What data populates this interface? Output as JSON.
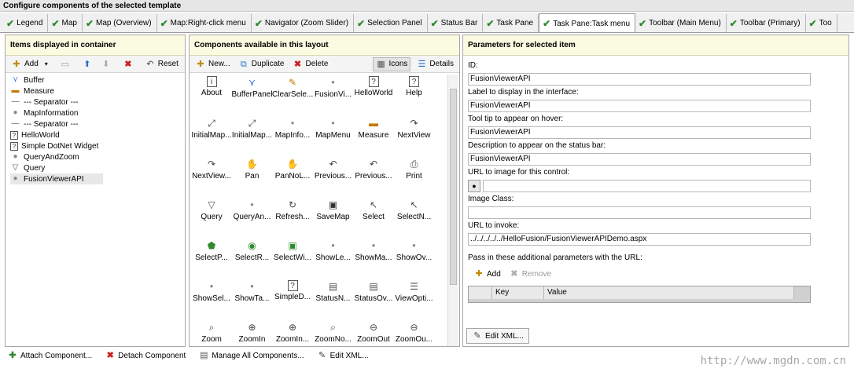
{
  "window_title": "Configure components of the selected template",
  "tabs": [
    {
      "label": "Legend"
    },
    {
      "label": "Map"
    },
    {
      "label": "Map (Overview)"
    },
    {
      "label": "Map:Right-click menu"
    },
    {
      "label": "Navigator (Zoom Slider)"
    },
    {
      "label": "Selection Panel"
    },
    {
      "label": "Status Bar"
    },
    {
      "label": "Task Pane"
    },
    {
      "label": "Task Pane:Task menu"
    },
    {
      "label": "Toolbar (Main Menu)"
    },
    {
      "label": "Toolbar (Primary)"
    },
    {
      "label": "Too"
    }
  ],
  "left_panel": {
    "title": "Items displayed in container",
    "add_label": "Add",
    "reset_label": "Reset",
    "items": [
      {
        "label": "Buffer",
        "icon": "buffer-icon"
      },
      {
        "label": "Measure",
        "icon": "measure-icon"
      },
      {
        "label": "--- Separator ---",
        "icon": "separator-icon"
      },
      {
        "label": "MapInformation",
        "icon": "bullet-icon"
      },
      {
        "label": "--- Separator ---",
        "icon": "separator-icon"
      },
      {
        "label": "HelloWorld",
        "icon": "help-icon"
      },
      {
        "label": "Simple DotNet Widget",
        "icon": "help-icon"
      },
      {
        "label": "QueryAndZoom",
        "icon": "bullet-icon"
      },
      {
        "label": "Query",
        "icon": "filter-icon"
      },
      {
        "label": "FusionViewerAPI",
        "icon": "bullet-icon"
      }
    ]
  },
  "middle_panel": {
    "title": "Components available in this layout",
    "new_label": "New...",
    "duplicate_label": "Duplicate",
    "delete_label": "Delete",
    "icons_label": "Icons",
    "details_label": "Details",
    "components": [
      {
        "label": "About",
        "icon": "info-icon"
      },
      {
        "label": "BufferPanel",
        "icon": "buffer-icon"
      },
      {
        "label": "ClearSele...",
        "icon": "clear-selection-icon"
      },
      {
        "label": "FusionVi...",
        "icon": "bullet-icon"
      },
      {
        "label": "HelloWorld",
        "icon": "help-icon"
      },
      {
        "label": "Help",
        "icon": "help-icon"
      },
      {
        "label": "InitialMap...",
        "icon": "zoom-extents-icon"
      },
      {
        "label": "InitialMap...",
        "icon": "zoom-extents-icon"
      },
      {
        "label": "MapInfo...",
        "icon": "bullet-icon"
      },
      {
        "label": "MapMenu",
        "icon": "bullet-icon"
      },
      {
        "label": "Measure",
        "icon": "measure-icon"
      },
      {
        "label": "NextView",
        "icon": "next-view-icon"
      },
      {
        "label": "NextView...",
        "icon": "next-view-icon"
      },
      {
        "label": "Pan",
        "icon": "pan-icon"
      },
      {
        "label": "PanNoL...",
        "icon": "pan-icon"
      },
      {
        "label": "Previous...",
        "icon": "previous-view-icon"
      },
      {
        "label": "Previous...",
        "icon": "previous-view-icon"
      },
      {
        "label": "Print",
        "icon": "print-icon"
      },
      {
        "label": "Query",
        "icon": "filter-icon"
      },
      {
        "label": "QueryAn...",
        "icon": "bullet-icon"
      },
      {
        "label": "Refresh...",
        "icon": "refresh-icon"
      },
      {
        "label": "SaveMap",
        "icon": "save-icon"
      },
      {
        "label": "Select",
        "icon": "select-icon"
      },
      {
        "label": "SelectN...",
        "icon": "select-icon"
      },
      {
        "label": "SelectP...",
        "icon": "select-polygon-icon"
      },
      {
        "label": "SelectR...",
        "icon": "select-radius-icon"
      },
      {
        "label": "SelectWi...",
        "icon": "select-within-icon"
      },
      {
        "label": "ShowLe...",
        "icon": "bullet-icon"
      },
      {
        "label": "ShowMa...",
        "icon": "bullet-icon"
      },
      {
        "label": "ShowOv...",
        "icon": "bullet-icon"
      },
      {
        "label": "ShowSel...",
        "icon": "bullet-icon"
      },
      {
        "label": "ShowTa...",
        "icon": "bullet-icon"
      },
      {
        "label": "SimpleD...",
        "icon": "help-icon"
      },
      {
        "label": "StatusN...",
        "icon": "status-icon"
      },
      {
        "label": "StatusOv...",
        "icon": "status-icon"
      },
      {
        "label": "ViewOpti...",
        "icon": "view-options-icon"
      },
      {
        "label": "Zoom",
        "icon": "zoom-icon"
      },
      {
        "label": "ZoomIn",
        "icon": "zoom-in-icon"
      },
      {
        "label": "ZoomIn...",
        "icon": "zoom-in-icon"
      },
      {
        "label": "ZoomNo...",
        "icon": "zoom-icon"
      },
      {
        "label": "ZoomOut",
        "icon": "zoom-out-icon"
      },
      {
        "label": "ZoomOu...",
        "icon": "zoom-out-icon"
      }
    ]
  },
  "right_panel": {
    "title": "Parameters for selected item",
    "id_label": "ID:",
    "id_value": "FusionViewerAPI",
    "label_label": "Label to display in the interface:",
    "label_value": "FusionViewerAPI",
    "tooltip_label": "Tool tip to appear on hover:",
    "tooltip_value": "FusionViewerAPI",
    "description_label": "Description to appear on the status bar:",
    "description_value": "FusionViewerAPI",
    "image_url_label": "URL to image for this control:",
    "image_url_value": "",
    "image_class_label": "Image Class:",
    "image_class_value": "",
    "invoke_url_label": "URL to invoke:",
    "invoke_url_value": "../../../../../HelloFusion/FusionViewerAPIDemo.aspx",
    "params_label": "Pass in these additional parameters with the URL:",
    "add_label": "Add",
    "remove_label": "Remove",
    "grid_headers": [
      "Key",
      "Value"
    ],
    "edit_xml_label": "Edit XML..."
  },
  "bottom_bar": {
    "attach_label": "Attach Component...",
    "detach_label": "Detach Component",
    "manage_label": "Manage All Components...",
    "edit_xml_label": "Edit XML..."
  },
  "watermark": "http://www.mgdn.com.cn"
}
